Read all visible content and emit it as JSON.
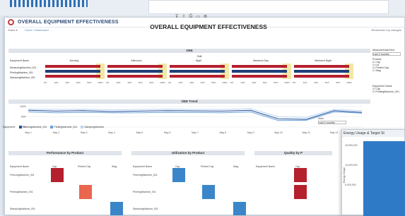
{
  "app": {
    "title": "OVERALL EQUIPMENT EFFECTIVENESS"
  },
  "subbar": {
    "left": "Share ▾",
    "crumb": "Home / Dashboard",
    "right": "Remember my changes"
  },
  "toolbar": {
    "icons": [
      "filter-icon",
      "share-icon",
      "print-icon",
      "fullscreen-icon",
      "settings-icon"
    ]
  },
  "dashboard": {
    "title": "OVERALL EQUIPMENT EFFECTIVENESS"
  },
  "oee": {
    "title": "OEE",
    "header_sub": "Shift",
    "columns": [
      "Equipment Name",
      "Morning",
      "Afternoon",
      "Night",
      "Weekend Day",
      "Weekend Night"
    ],
    "rows": [
      "MeasuringMachine_001",
      "PrintingMachine_001",
      "StampingMachine_001"
    ],
    "axis_ticks": [
      "0%",
      "20%",
      "40%",
      "60%",
      "80%",
      "100%"
    ],
    "colors": {
      "oee": "#b5202e",
      "target": "#1f3f7a",
      "band": "#f3e7a6"
    }
  },
  "trend": {
    "title": "OEE Trend",
    "yticks": [
      "100%",
      "50%",
      "0%"
    ],
    "xticks": [
      "May 1",
      "May 2",
      "May 3",
      "May 4",
      "May 5",
      "May 6",
      "May 7",
      "May 8",
      "May 9",
      "May 10",
      "May 11",
      "May 12",
      "May 13"
    ],
    "legend_title": "Equipment:",
    "legend": [
      "FreezingMachine_001",
      "PrintingMachine_001",
      "StampingMachine"
    ],
    "legend_colors": [
      "#1f4e9c",
      "#6aa0d6",
      "#b9d4ee"
    ]
  },
  "side": {
    "measure_label": "Measure/Date/Time",
    "measure_value": "Last 3 months",
    "product_label": "Product",
    "products": [
      "Cap",
      "Lid",
      "Printed Cap",
      "Stag"
    ],
    "equipment_label": "Equipment Name",
    "equipment": [
      "Cap",
      "PrintingMachine_001"
    ],
    "view_label": "View",
    "view_value": "Last 3 months"
  },
  "perf": {
    "title": "Performance by Product",
    "cols": [
      "Equipment Name",
      "Cap",
      "Printed Cap",
      "Stag"
    ],
    "rows": [
      "FreezingMachine_001",
      "PrintingMachine_001",
      "StampingMachine_001"
    ]
  },
  "util": {
    "title": "Utilization by Product",
    "cols": [
      "Equipment Name",
      "Cap",
      "Printed Cap",
      "Stag"
    ],
    "rows": [
      "FreezingMachine_001",
      "PrintingMachine_001",
      "StampingMachine_001"
    ]
  },
  "quality": {
    "title": "Quality by P",
    "cols": [
      "Equipment Name",
      "Cap"
    ],
    "rows": [
      "",
      "",
      ""
    ]
  },
  "energy": {
    "title": "Energy Usage & Target St",
    "yticks": [
      "15,000,000",
      "10,000,000",
      "5,000,000"
    ],
    "ylabel": "Energy Usage"
  }
}
